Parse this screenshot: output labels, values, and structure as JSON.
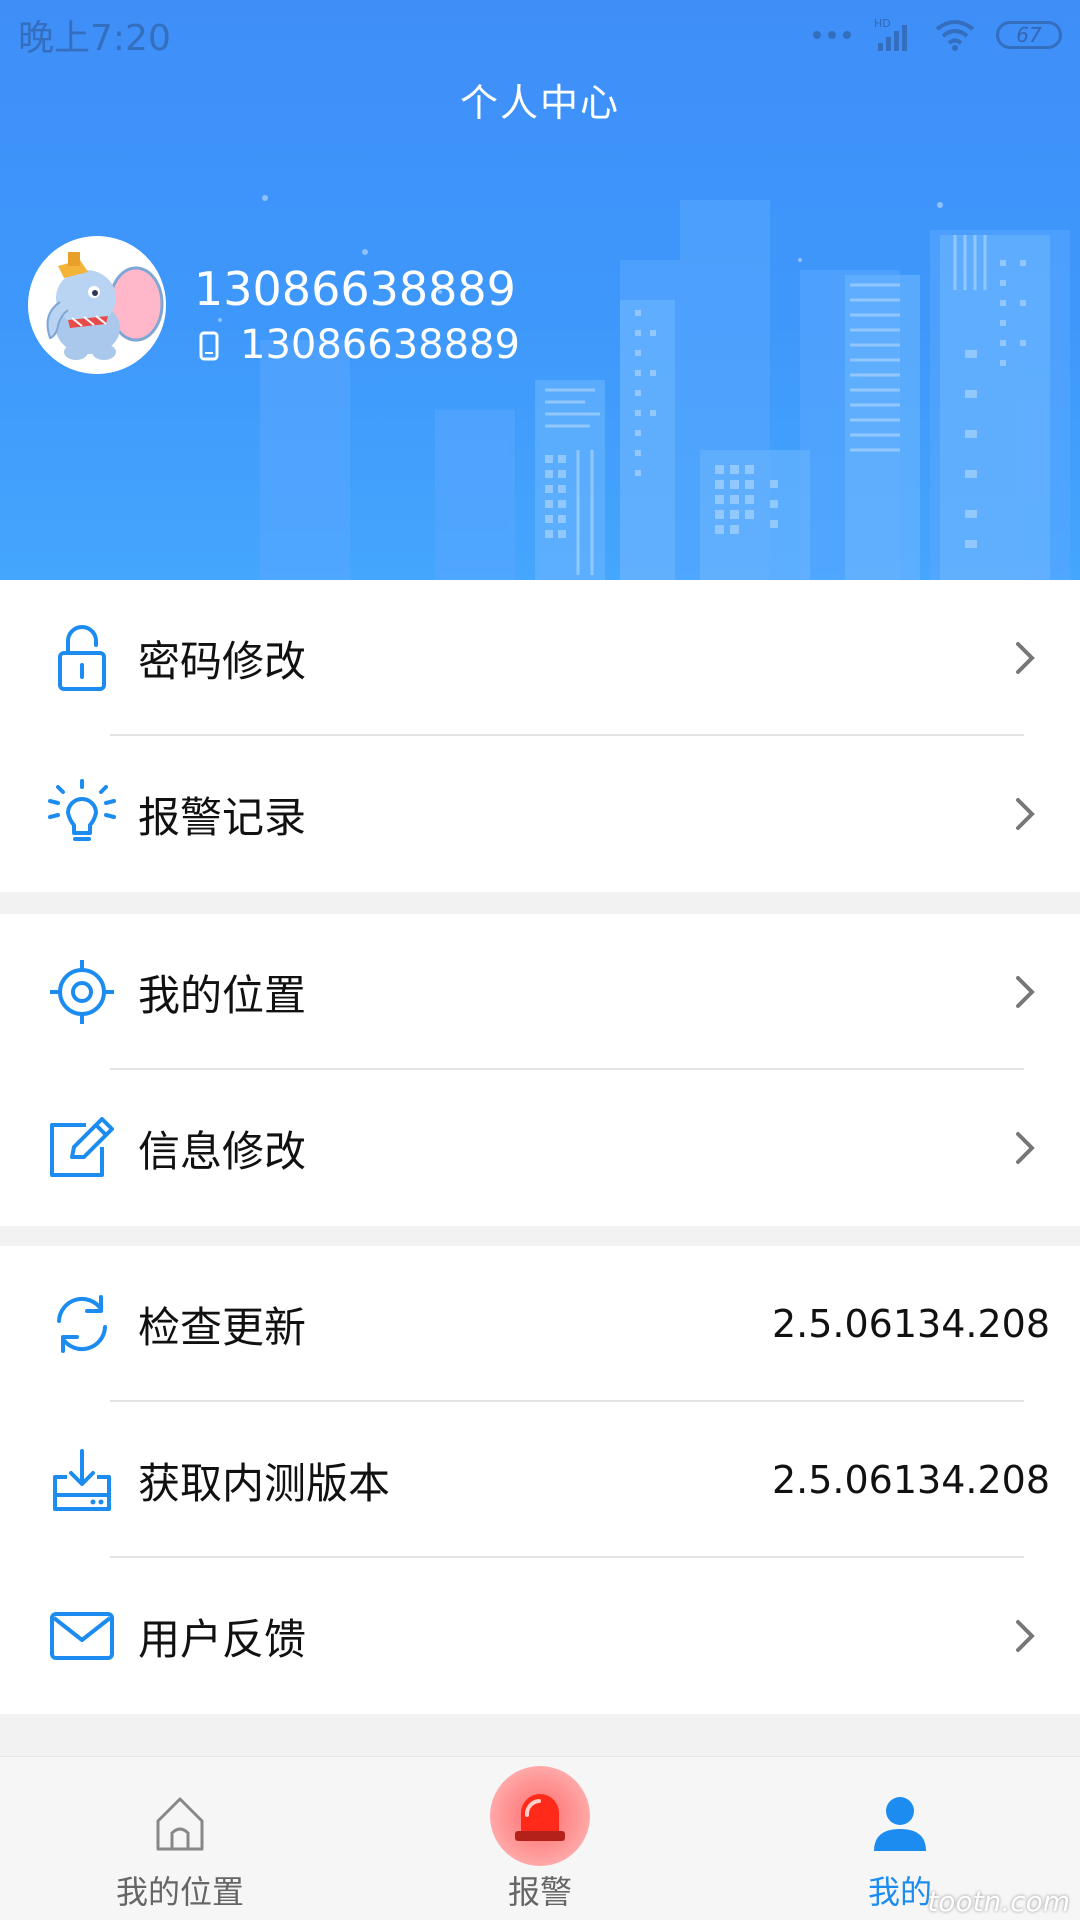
{
  "status_bar": {
    "time": "晚上7:20",
    "battery": "67",
    "network": "HD"
  },
  "header": {
    "title": "个人中心",
    "user_name": "13086638889",
    "user_phone": "13086638889"
  },
  "menu_groups": [
    {
      "items": [
        {
          "label": "密码修改",
          "icon": "lock-icon"
        },
        {
          "label": "报警记录",
          "icon": "bulb-icon"
        }
      ]
    },
    {
      "items": [
        {
          "label": "我的位置",
          "icon": "target-icon"
        },
        {
          "label": "信息修改",
          "icon": "edit-icon"
        }
      ]
    },
    {
      "items": [
        {
          "label": "检查更新",
          "icon": "refresh-icon",
          "value": "2.5.06134.208"
        },
        {
          "label": "获取内测版本",
          "icon": "download-icon",
          "value": "2.5.06134.208"
        },
        {
          "label": "用户反馈",
          "icon": "mail-icon"
        }
      ]
    }
  ],
  "bottom_nav": {
    "items": [
      {
        "label": "我的位置",
        "icon": "home-icon"
      },
      {
        "label": "报警",
        "icon": "alarm-light-icon"
      },
      {
        "label": "我的",
        "icon": "user-icon",
        "active": true
      }
    ]
  },
  "colors": {
    "accent": "#1d8cf0",
    "header": "#3e98fb",
    "alarm": "#ff3b30"
  },
  "watermark": "tootn.com"
}
